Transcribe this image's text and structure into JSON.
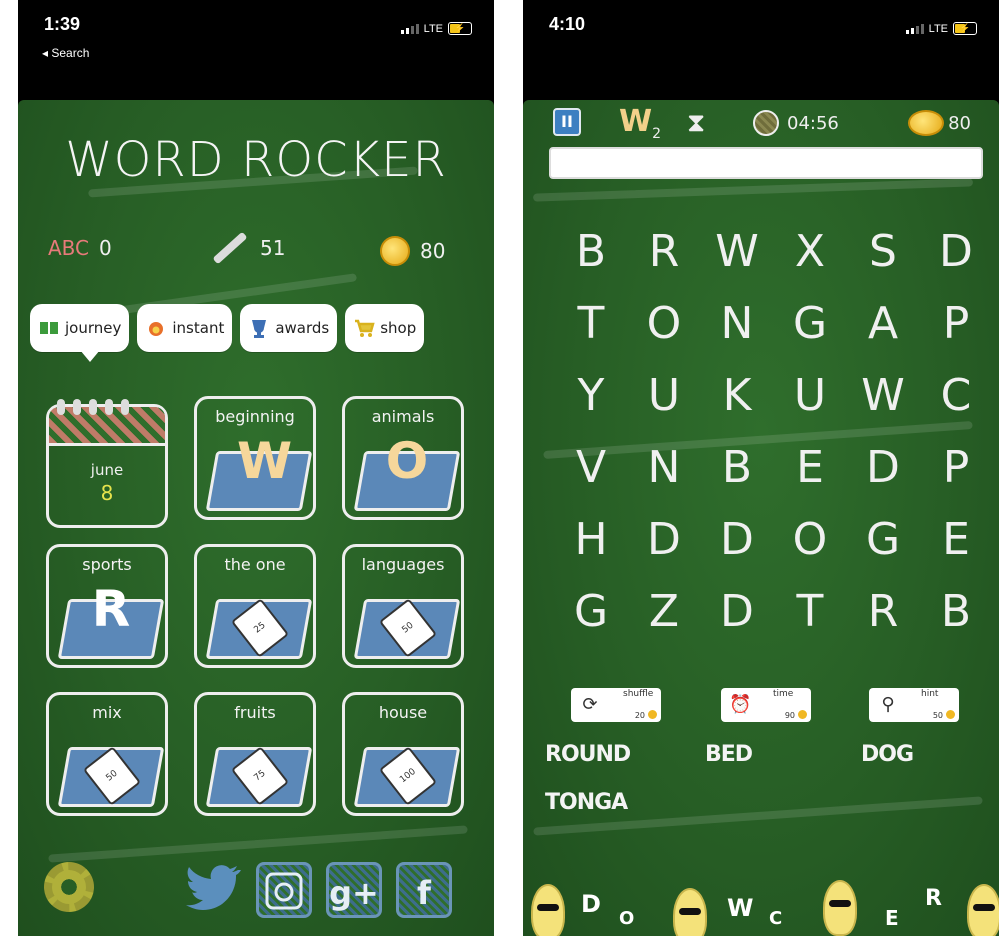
{
  "left_screen": {
    "status": {
      "time": "1:39",
      "back": "◂ Search",
      "network": "LTE"
    },
    "title": "WORD ROCKER",
    "stats": {
      "abc_label": "ABC",
      "abc_value": "0",
      "chalk_value": "51",
      "coins_value": "80"
    },
    "tabs": [
      {
        "label": "journey",
        "icon": "book-icon"
      },
      {
        "label": "instant",
        "icon": "fire-icon"
      },
      {
        "label": "awards",
        "icon": "trophy-icon"
      },
      {
        "label": "shop",
        "icon": "cart-icon"
      }
    ],
    "calendar": {
      "month": "june",
      "day": "8"
    },
    "categories": [
      {
        "label": "beginning",
        "letter": "W",
        "letter_color": "#f6d79b"
      },
      {
        "label": "animals",
        "letter": "O",
        "letter_color": "#f6d79b"
      },
      {
        "label": "sports",
        "letter": "R",
        "letter_color": "#ffffff"
      },
      {
        "label": "the one",
        "price": "25"
      },
      {
        "label": "languages",
        "price": "50"
      },
      {
        "label": "mix",
        "price": "50"
      },
      {
        "label": "fruits",
        "price": "75"
      },
      {
        "label": "house",
        "price": "100"
      }
    ],
    "bottom": {
      "twitter": "twitter-icon",
      "instagram": "instagram-icon",
      "googleplus_label": "g+",
      "facebook_label": "f"
    }
  },
  "right_screen": {
    "status": {
      "time": "4:10",
      "network": "LTE"
    },
    "level": {
      "letter": "W",
      "sub": "2"
    },
    "timer": "04:56",
    "coins": "80",
    "grid": [
      [
        "B",
        "R",
        "W",
        "X",
        "S",
        "D"
      ],
      [
        "T",
        "O",
        "N",
        "G",
        "A",
        "P"
      ],
      [
        "Y",
        "U",
        "K",
        "U",
        "W",
        "C"
      ],
      [
        "V",
        "N",
        "B",
        "E",
        "D",
        "P"
      ],
      [
        "H",
        "D",
        "D",
        "O",
        "G",
        "E"
      ],
      [
        "G",
        "Z",
        "D",
        "T",
        "R",
        "B"
      ]
    ],
    "powerups": [
      {
        "label": "shuffle",
        "cost": "20",
        "icon": "shuffle-icon"
      },
      {
        "label": "time",
        "cost": "90",
        "icon": "alarm-clock-icon"
      },
      {
        "label": "hint",
        "cost": "50",
        "icon": "magnifier-icon"
      }
    ],
    "found_words": [
      "ROUND",
      "BED",
      "DOG",
      "TONGA"
    ],
    "rack_letters": [
      "D",
      "O",
      "W",
      "C",
      "E",
      "R"
    ]
  },
  "colors": {
    "board": "#2f6e2c",
    "accent_blue": "#5b88b8",
    "coin": "#f0b823"
  }
}
